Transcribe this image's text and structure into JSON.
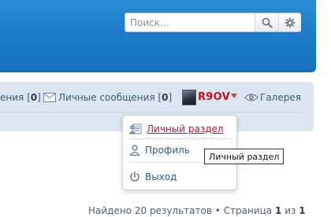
{
  "search": {
    "placeholder": "Поиск..."
  },
  "nav": {
    "notifications_label_partial": "ения",
    "notifications_count": "0",
    "messages_label": "Личные сообщения",
    "messages_count": "0",
    "username": "R9OV",
    "gallery_label": "Галерея"
  },
  "user_menu": {
    "items": [
      {
        "label": "Личный раздел",
        "icon": "personal-section-icon"
      },
      {
        "label": "Профиль",
        "icon": "profile-icon"
      },
      {
        "label": "Выход",
        "icon": "power-icon"
      }
    ]
  },
  "tooltip": {
    "text": "Личный раздел"
  },
  "results": {
    "found_text": "Найдено 20 результатов",
    "page_word": "Страница",
    "current_page": "1",
    "of_word": "из",
    "total_pages": "1"
  },
  "colors": {
    "header_blue": "#1b79c8",
    "username_red": "#c0131b",
    "active_menu_red": "#b0173d",
    "link_blue": "#2f5a8a"
  }
}
